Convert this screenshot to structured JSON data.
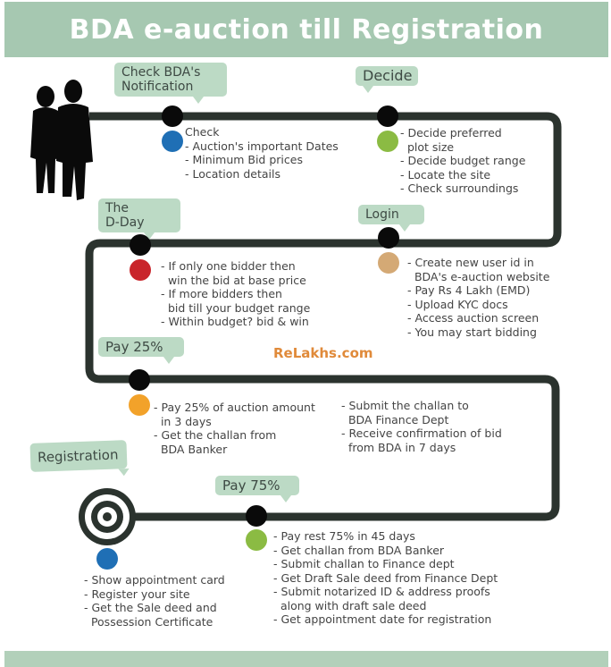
{
  "title": "BDA e-auction till Registration",
  "watermark": "ReLakhs.com",
  "steps": [
    {
      "label": "Check BDA's\nNotification",
      "color": "#1f6fb5",
      "text": "Check\n- Auction's important Dates\n- Minimum Bid prices\n- Location details"
    },
    {
      "label": "Decide",
      "color": "#8bbb43",
      "text": "- Decide preferred\n  plot size\n- Decide budget range\n- Locate the site\n- Check surroundings"
    },
    {
      "label": "Login",
      "color": "#d4a975",
      "text": "- Create new user id in\n  BDA's e-auction website\n- Pay Rs 4 Lakh (EMD)\n- Upload KYC docs\n- Access auction screen\n- You may start bidding"
    },
    {
      "label": "The\nD-Day",
      "color": "#c9252b",
      "text": "- If only one bidder then\n  win the bid at base price\n- If more bidders then\n  bid till your budget range\n- Within budget? bid & win"
    },
    {
      "label": "Pay 25%",
      "color": "#f2a22a",
      "text": "- Pay 25% of auction amount\n  in 3 days\n- Get the challan from\n  BDA Banker"
    },
    {
      "label": "",
      "color": "",
      "text": "- Submit the challan to\n  BDA Finance Dept\n- Receive confirmation of bid\n  from BDA in 7 days"
    },
    {
      "label": "Pay 75%",
      "color": "#8bbb43",
      "text": "- Pay rest 75% in 45 days\n- Get challan from BDA Banker\n- Submit challan to Finance dept\n- Get Draft Sale deed from Finance Dept\n- Submit notarized ID & address proofs\n  along with draft sale deed\n- Get appointment date for registration"
    },
    {
      "label": "Registration",
      "color": "#1f6fb5",
      "text": "- Show appointment card\n- Register your site\n- Get the Sale deed and\n  Possession Certificate"
    }
  ]
}
